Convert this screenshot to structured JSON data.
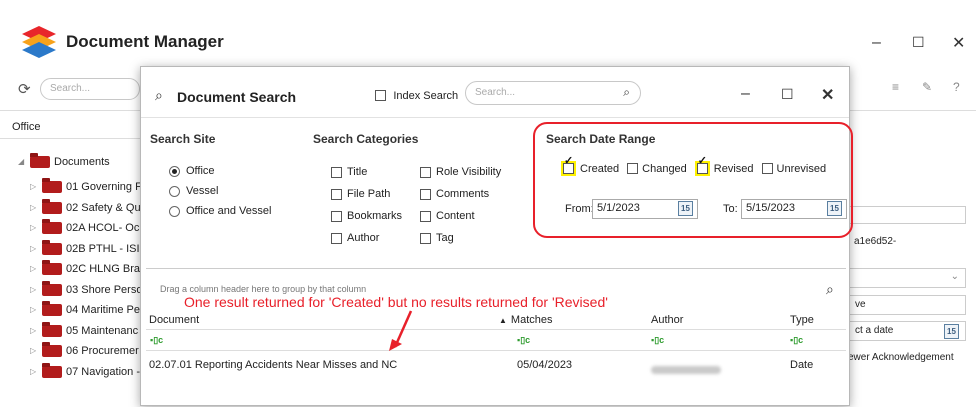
{
  "app": {
    "title": "Document Manager",
    "window_controls": {
      "minimize": "–",
      "maximize": "☐",
      "close": "✕"
    },
    "search_placeholder": "Search...",
    "office_tab": "Office",
    "tree": {
      "root": "Documents",
      "items": [
        "01 Governing F",
        "02 Safety & Qu",
        "02A HCOL- Oc",
        "02B PTHL - ISI",
        "02C HLNG Bra",
        "03 Shore Perso",
        "04 Maritime Pe",
        "05 Maintenanc",
        "06 Procuremer",
        "07 Navigation -"
      ]
    },
    "right_panel": {
      "guid": "a1e6d52-",
      "select_label": "ve",
      "date_placeholder": "ct a date",
      "ack_label": "ewer Acknowledgement"
    }
  },
  "dialog": {
    "title": "Document Search",
    "index_search_label": "Index Search",
    "search_placeholder": "Search...",
    "window_controls": {
      "minimize": "–",
      "maximize": "☐",
      "close": "✕"
    },
    "search_site": {
      "heading": "Search Site",
      "options": [
        {
          "label": "Office",
          "selected": true
        },
        {
          "label": "Vessel",
          "selected": false
        },
        {
          "label": "Office and Vessel",
          "selected": false
        }
      ]
    },
    "search_categories": {
      "heading": "Search Categories",
      "left": [
        "Title",
        "File Path",
        "Bookmarks",
        "Author"
      ],
      "right": [
        "Role Visibility",
        "Comments",
        "Content",
        "Tag"
      ]
    },
    "date_range": {
      "heading": "Search Date Range",
      "options": [
        {
          "label": "Created",
          "checked": true,
          "highlighted": true
        },
        {
          "label": "Changed",
          "checked": false,
          "highlighted": false
        },
        {
          "label": "Revised",
          "checked": true,
          "highlighted": true
        },
        {
          "label": "Unrevised",
          "checked": false,
          "highlighted": false
        }
      ],
      "from_label": "From:",
      "from_value": "5/1/2023",
      "to_label": "To:",
      "to_value": "5/15/2023",
      "calendar_icon_text": "15"
    },
    "grid": {
      "group_hint": "Drag a column header here to group by that column",
      "annotation": "One result returned for 'Created' but no results returned for 'Revised'",
      "columns": {
        "document": "Document",
        "matches": "Matches",
        "author": "Author",
        "type": "Type"
      },
      "sort_indicator": "▲",
      "filter_glyph": "▪▯c",
      "rows": [
        {
          "document": "02.07.01 Reporting Accidents Near Misses and NC",
          "matches": "05/04/2023",
          "type": "Date"
        }
      ]
    }
  },
  "colors": {
    "accent_red": "#e8202a",
    "highlight": "#fff200",
    "folder": "#b21c1c"
  }
}
